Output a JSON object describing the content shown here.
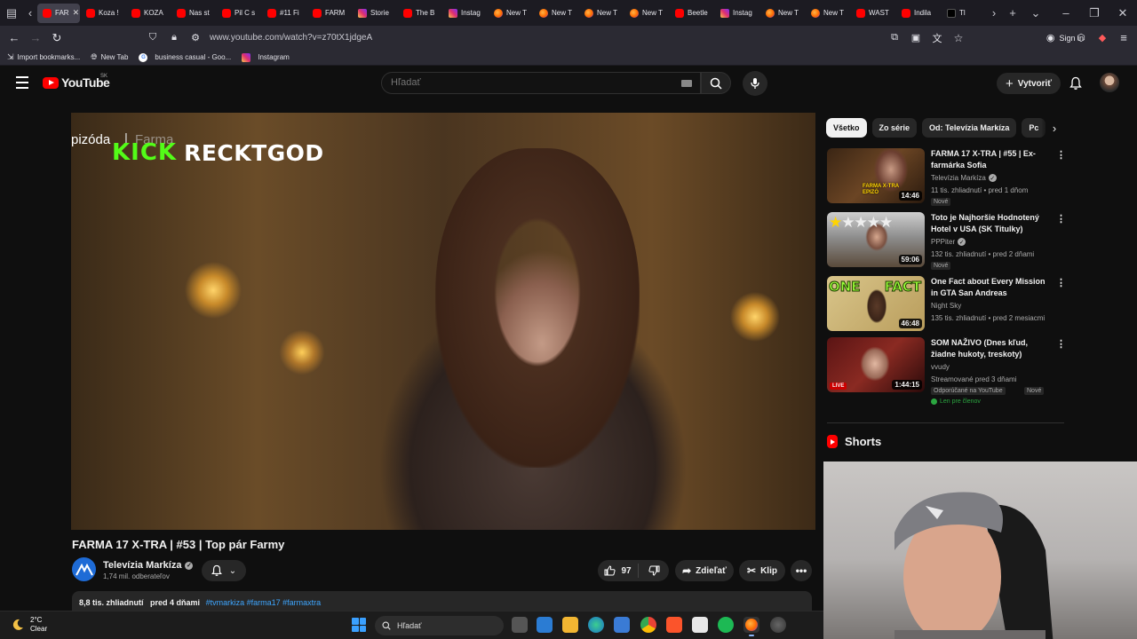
{
  "browser": {
    "tabs": [
      {
        "label": "FAR",
        "icon": "youtube-icon",
        "active": true
      },
      {
        "label": "Koza !",
        "icon": "youtube-icon"
      },
      {
        "label": "KOZA",
        "icon": "youtube-icon"
      },
      {
        "label": "Nas st",
        "icon": "youtube-icon"
      },
      {
        "label": "Pil C s",
        "icon": "youtube-icon"
      },
      {
        "label": "#11 Fi",
        "icon": "youtube-icon"
      },
      {
        "label": "FARM",
        "icon": "youtube-icon"
      },
      {
        "label": "Storie",
        "icon": "instagram-icon"
      },
      {
        "label": "The B",
        "icon": "youtube-icon"
      },
      {
        "label": "Instag",
        "icon": "instagram-icon"
      },
      {
        "label": "New T",
        "icon": "firefox-icon"
      },
      {
        "label": "New T",
        "icon": "firefox-icon"
      },
      {
        "label": "New T",
        "icon": "firefox-icon"
      },
      {
        "label": "New T",
        "icon": "firefox-icon"
      },
      {
        "label": "Beetle",
        "icon": "youtube-icon"
      },
      {
        "label": "Instag",
        "icon": "instagram-icon"
      },
      {
        "label": "New T",
        "icon": "firefox-icon"
      },
      {
        "label": "New T",
        "icon": "firefox-icon"
      },
      {
        "label": "WAST",
        "icon": "youtube-icon"
      },
      {
        "label": "Indila",
        "icon": "youtube-icon"
      },
      {
        "label": "Tl",
        "icon": "x-icon"
      }
    ],
    "url": "www.youtube.com/watch?v=z70tX1jdgeA",
    "sign_in": "Sign in",
    "bookmarks": [
      {
        "label": "Import bookmarks...",
        "icon": "import-icon"
      },
      {
        "label": "New Tab",
        "icon": "globe-icon"
      },
      {
        "label": "business casual - Goo...",
        "icon": "google-icon"
      },
      {
        "label": "Instagram",
        "icon": "instagram-icon"
      }
    ]
  },
  "youtube": {
    "logo_text": "YouTube",
    "country_code": "SK",
    "search_placeholder": "Hľadať",
    "create_label": "Vytvoriť"
  },
  "player": {
    "overlay_episode": "pizóda",
    "overlay_separator": "|",
    "overlay_show": "Farma",
    "kick_word": "KICK",
    "kick_user": "RECKTGOD"
  },
  "video": {
    "title": "FARMA 17 X-TRA | #53 | Top pár Farmy",
    "channel_name": "Televízia Markíza",
    "channel_subs": "1,74 mil. odberateľov",
    "likes": "97",
    "share_label": "Zdieľať",
    "clip_label": "Klip",
    "views": "8,8 tis. zhliadnutí",
    "published": "pred 4 dňami",
    "tags": "#tvmarkiza #farma17 #farmaxtra"
  },
  "sidebar": {
    "chips": [
      "Všetko",
      "Zo série",
      "Od: Televízia Markíza",
      "Pc"
    ],
    "recommendations": [
      {
        "title": "FARMA 17 X-TRA | #55 | Ex-farmárka Sofia",
        "channel": "Televízia Markíza",
        "verified": true,
        "views": "11 tis. zhliadnutí • pred 1 dňom",
        "badge": "Nové",
        "duration": "14:46",
        "thumb_text": "FARMA X-TRA EPIZÓ"
      },
      {
        "title": "Toto je Najhoršie Hodnotený Hotel v USA (SK Titulky)",
        "channel": "PPPiter",
        "verified": true,
        "views": "132 tis. zhliadnutí • pred 2 dňami",
        "badge": "Nové",
        "duration": "59:06"
      },
      {
        "title": "One Fact about Every Mission in GTA San Andreas",
        "channel": "Night Sky",
        "verified": false,
        "views": "135 tis. zhliadnutí • pred 2 mesiacmi",
        "duration": "46:48",
        "thumb_text": "ONE FACT"
      },
      {
        "title": "SOM NAŽIVO (Dnes kľud, žiadne hukoty, treskoty)",
        "channel": "vvudy",
        "verified": false,
        "views": "Streamované pred 3 dňami",
        "badge": "Odporúčané na YouTube",
        "badge2": "Nové",
        "members": "Len pre členov",
        "duration": "1:44:15",
        "live_label": "LIVE"
      }
    ],
    "shorts_label": "Shorts"
  },
  "taskbar": {
    "temperature": "2°C",
    "condition": "Clear",
    "search_label": "Hľadať"
  },
  "colors": {
    "youtube_red": "#ff0000",
    "kick_green": "#53fc18",
    "link_blue": "#3ea6ff",
    "members_green": "#2ba640"
  }
}
